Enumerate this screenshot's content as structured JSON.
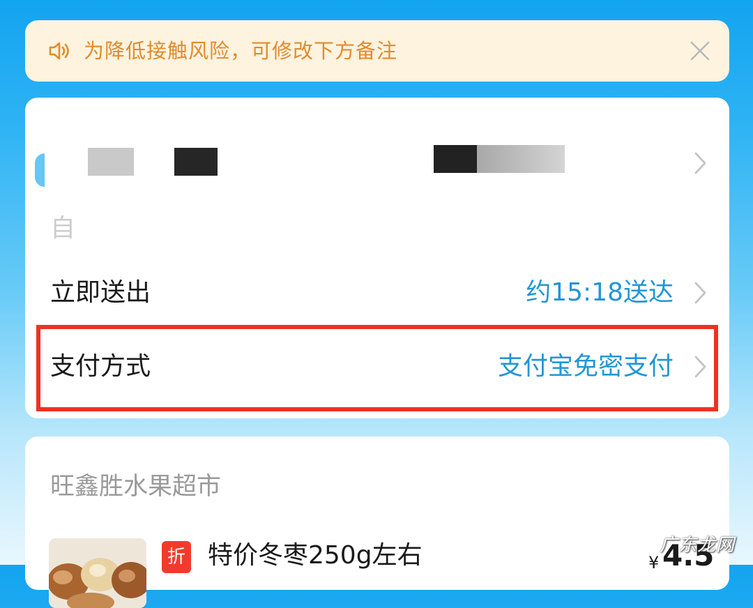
{
  "notice": {
    "text": "为降低接触风险，可修改下方备注",
    "icon": "speaker-icon",
    "close_icon": "close-icon"
  },
  "address": {
    "line2_fragment": "自"
  },
  "delivery": {
    "label": "立即送出",
    "value": "约15:18送达"
  },
  "payment": {
    "label": "支付方式",
    "value": "支付宝免密支付"
  },
  "store": {
    "name": "旺鑫胜水果超市",
    "item": {
      "badge": "折",
      "name": "特价冬枣250g左右",
      "currency": "¥",
      "price": "4.5"
    }
  },
  "watermark": "广东龙网",
  "colors": {
    "accent_blue": "#2196d6",
    "notice_text": "#e38a2b",
    "highlight_red": "#ee3122",
    "badge_red": "#f23a2c"
  }
}
